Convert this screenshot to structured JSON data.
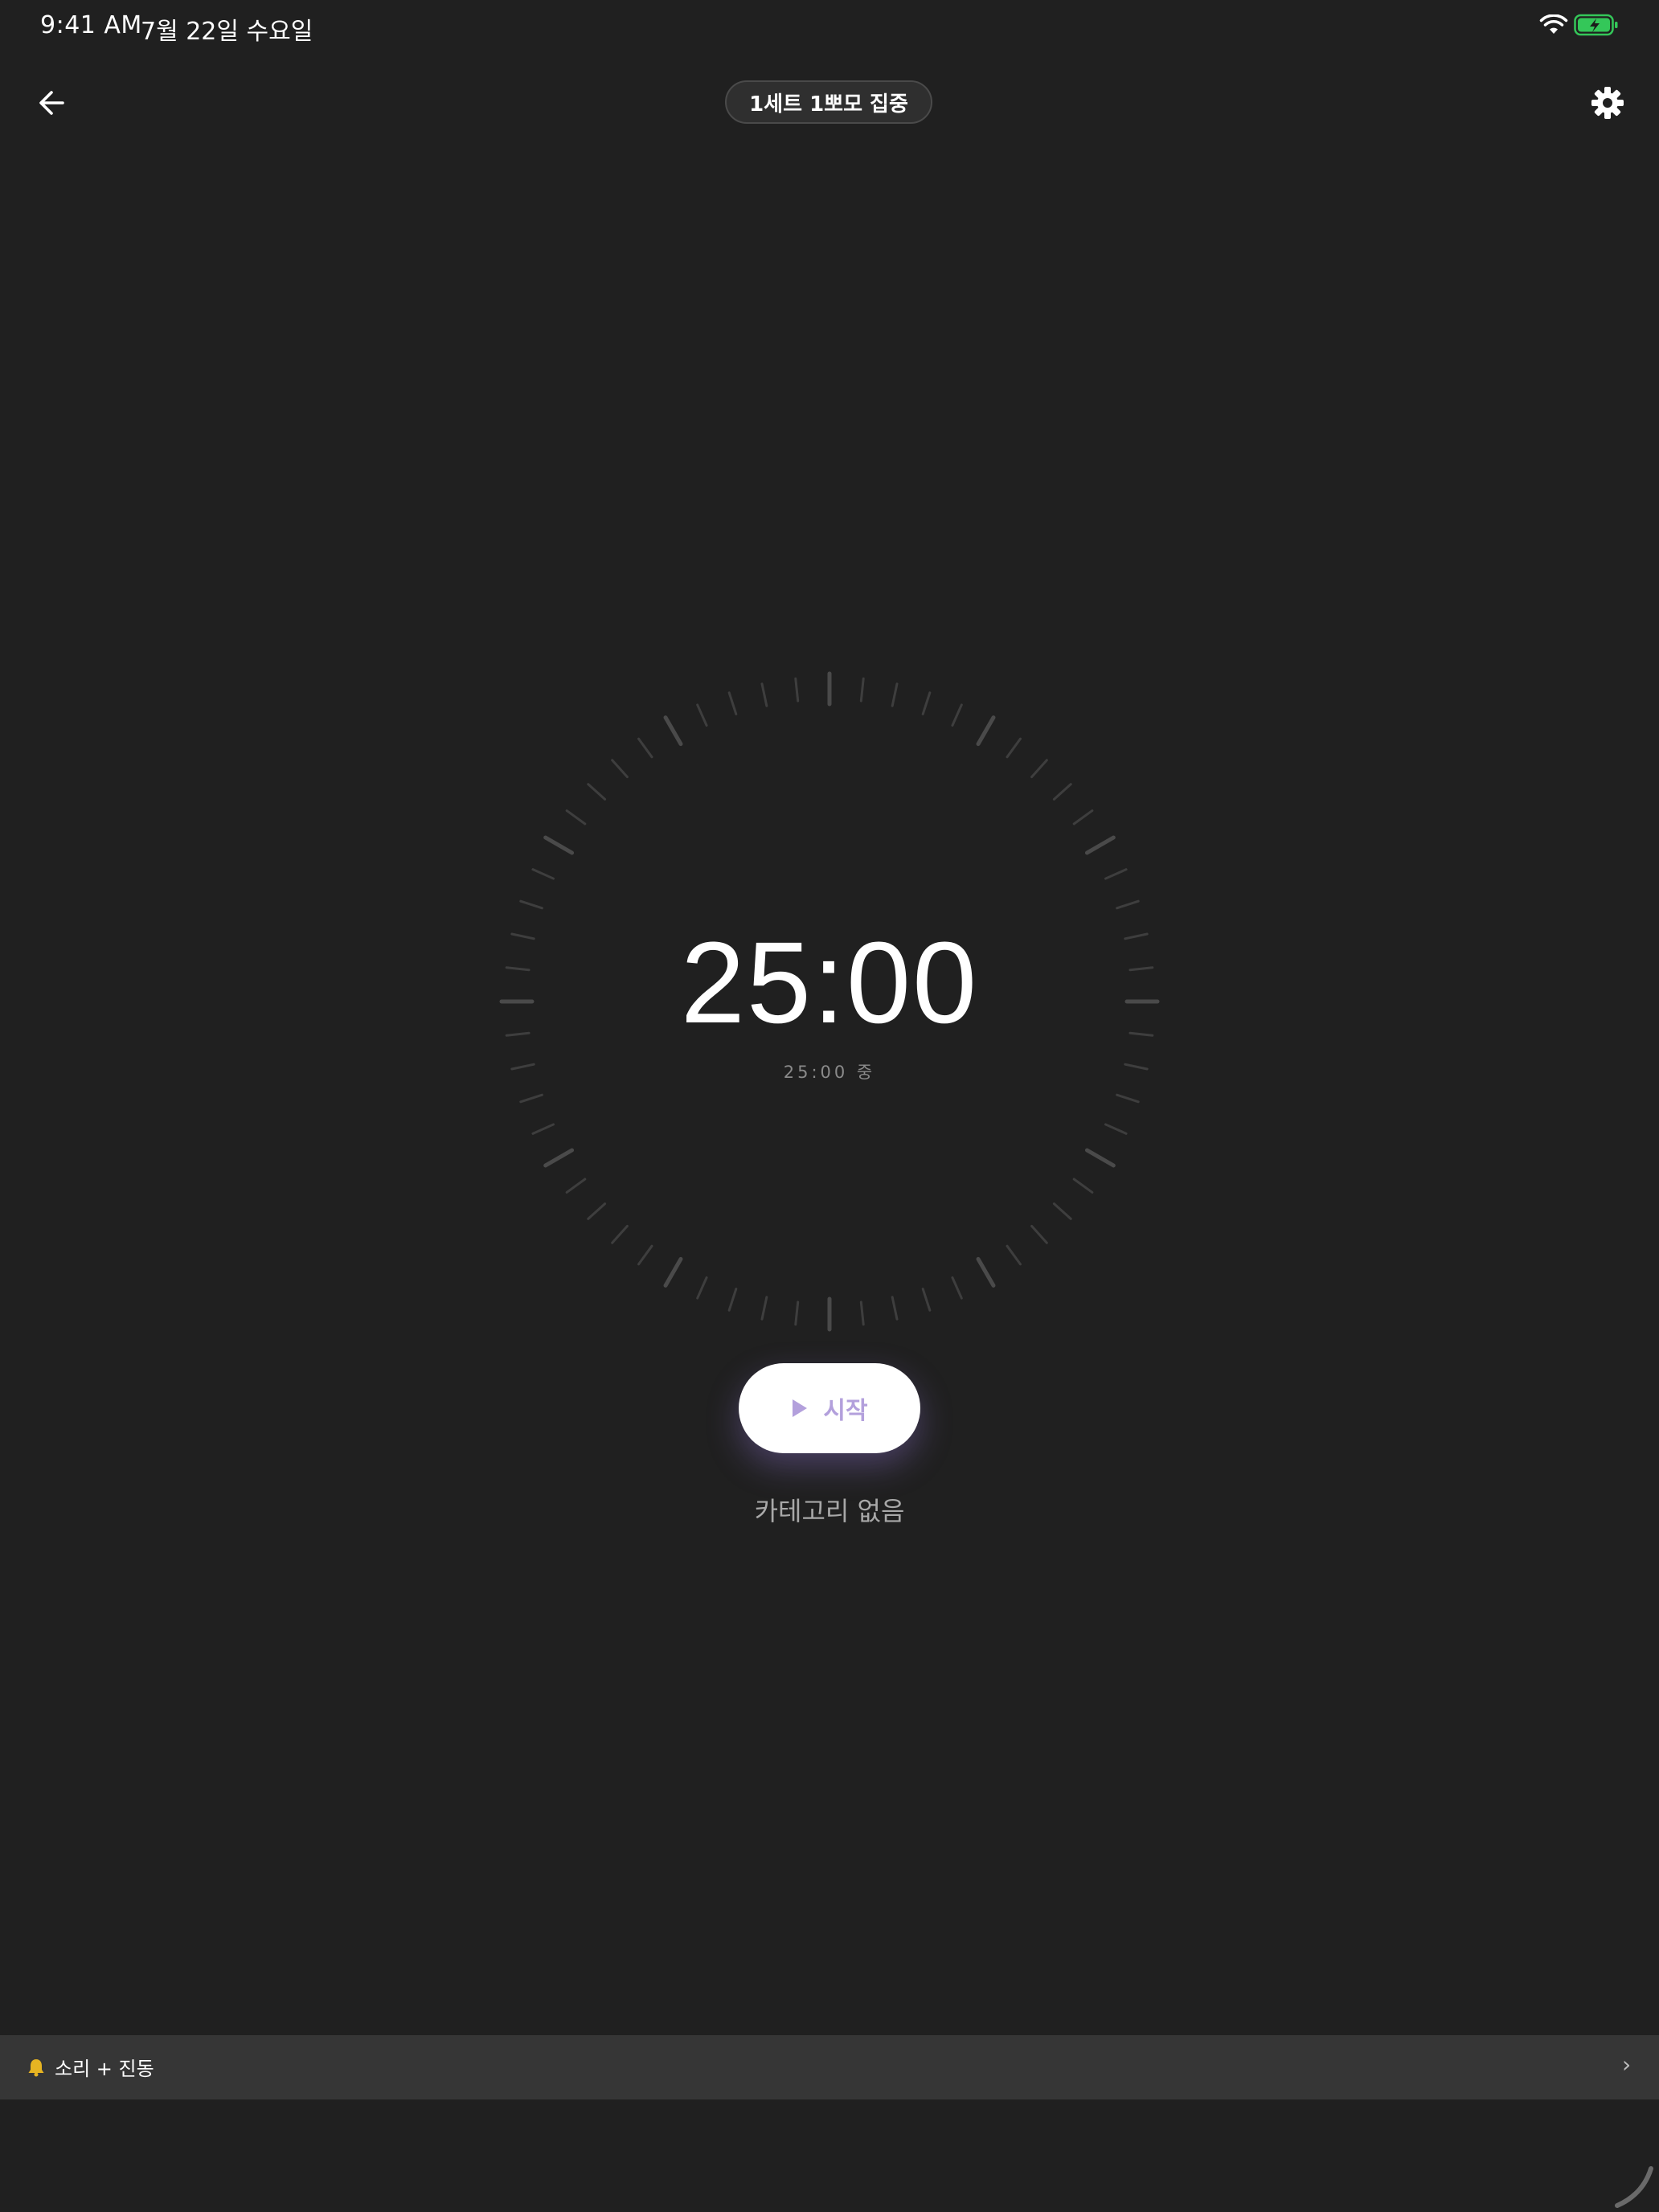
{
  "status_bar": {
    "time": "9:41 AM",
    "date": "7월 22일 수요일",
    "battery_color": "#34c759"
  },
  "header": {
    "title": "1세트 1뽀모 집중"
  },
  "timer": {
    "display": "25:00",
    "subtitle": "25:00 중",
    "tick_count": 60,
    "progress": 0
  },
  "controls": {
    "start_label": "시작",
    "accent_color": "#b3a0dc"
  },
  "category": {
    "label": "카테고리 없음"
  },
  "bottom_bar": {
    "alert_icon": "bell-icon",
    "sound_label": "소리 + 진동",
    "chevron": "›"
  }
}
